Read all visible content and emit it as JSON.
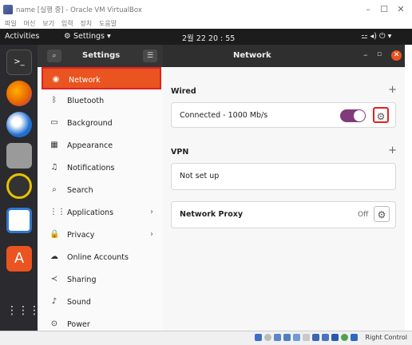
{
  "host": {
    "window_title": "name [실행 중] - Oracle VM VirtualBox",
    "menu": [
      "파일",
      "머신",
      "보기",
      "입력",
      "장치",
      "도움말"
    ],
    "status_right": "Right Control"
  },
  "topbar": {
    "activities": "Activities",
    "app_menu": "Settings ▾",
    "clock": "2월 22  20 : 55",
    "tray": "⚍  ◂)  ⏻  ▾"
  },
  "settings": {
    "title": "Settings",
    "page_title": "Network",
    "sidebar": [
      {
        "label": "Network",
        "icon": "network-icon",
        "glyph": "◉",
        "active": true
      },
      {
        "label": "Bluetooth",
        "icon": "bluetooth-icon",
        "glyph": "ᛒ"
      },
      {
        "label": "Background",
        "icon": "background-icon",
        "glyph": "▭"
      },
      {
        "label": "Appearance",
        "icon": "appearance-icon",
        "glyph": "▦"
      },
      {
        "label": "Notifications",
        "icon": "notifications-icon",
        "glyph": "♫"
      },
      {
        "label": "Search",
        "icon": "search-icon",
        "glyph": "⌕"
      },
      {
        "label": "Applications",
        "icon": "applications-icon",
        "glyph": "⋮⋮",
        "chevron": "›"
      },
      {
        "label": "Privacy",
        "icon": "privacy-icon",
        "glyph": "🔒",
        "chevron": "›"
      },
      {
        "label": "Online Accounts",
        "icon": "online-accounts-icon",
        "glyph": "☁"
      },
      {
        "label": "Sharing",
        "icon": "sharing-icon",
        "glyph": "≺"
      },
      {
        "label": "Sound",
        "icon": "sound-icon",
        "glyph": "♪"
      },
      {
        "label": "Power",
        "icon": "power-icon",
        "glyph": "⊙"
      }
    ]
  },
  "network": {
    "wired_title": "Wired",
    "wired_status": "Connected - 1000 Mb/s",
    "wired_switch_on": true,
    "vpn_title": "VPN",
    "vpn_status": "Not set up",
    "proxy_title": "Network Proxy",
    "proxy_status": "Off"
  },
  "colors": {
    "accent": "#e95420",
    "highlight_border": "#e32020",
    "switch_on": "#7f3b7a"
  }
}
